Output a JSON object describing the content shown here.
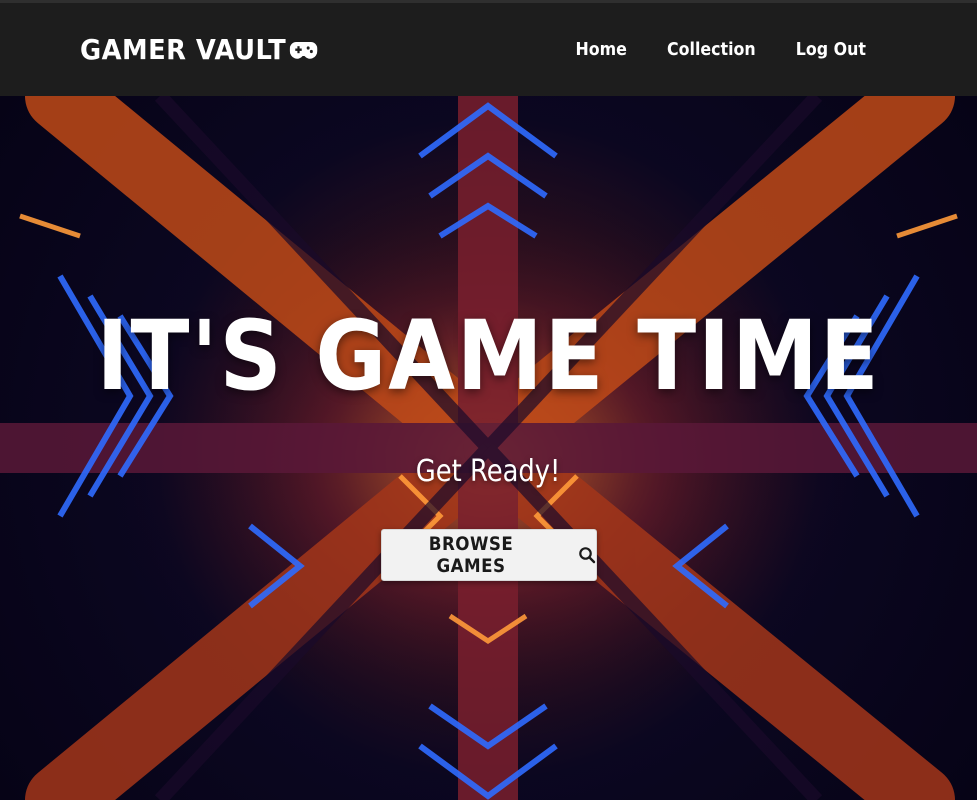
{
  "header": {
    "brand": "GAMER VAULT",
    "brand_icon": "game-controller-icon",
    "nav": [
      {
        "label": "Home"
      },
      {
        "label": "Collection"
      },
      {
        "label": "Log Out"
      }
    ]
  },
  "hero": {
    "title": "IT'S GAME TIME",
    "subtitle": "Get Ready!",
    "button_label": "BROWSE GAMES",
    "button_icon": "search-icon"
  },
  "colors": {
    "header_bg": "#1d1d1d",
    "text": "#ffffff",
    "button_bg": "#f2f2f2",
    "accent_orange": "#e0641c",
    "accent_blue": "#2f6bff"
  }
}
